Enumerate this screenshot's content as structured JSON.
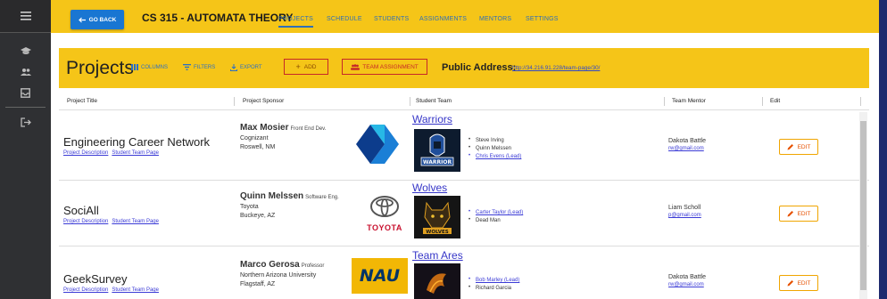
{
  "rail": {
    "icons": [
      "hamburger-menu-icon",
      "school-cap-icon",
      "people-icon",
      "inbox-icon",
      "logout-icon"
    ]
  },
  "topbar": {
    "go_back_label": "GO BACK",
    "course_title": "CS 315 - AUTOMATA THEORY",
    "tabs": [
      "PROJECTS",
      "SCHEDULE",
      "STUDENTS",
      "ASSIGNMENTS",
      "MENTORS",
      "SETTINGS"
    ],
    "active_tab": "PROJECTS"
  },
  "panel": {
    "title": "Projects",
    "columns_label": "COLUMNS",
    "filters_label": "FILTERS",
    "export_label": "EXPORT",
    "add_label": "ADD",
    "team_assignment_label": "TEAM ASSIGNMENT",
    "public_address_label": "Public Address:",
    "public_address_url": "http://34.216.91.228/team-page/30/"
  },
  "table": {
    "headers": [
      "Project Title",
      "Project Sponsor",
      "Student Team",
      "Team Mentor",
      "Edit"
    ],
    "rows": [
      {
        "project_title": "Engineering Career Network",
        "desc_link": "Project Description",
        "team_link": "Student Team Page",
        "sponsor_name": "Max Mosier",
        "sponsor_role": "Front End Dev.",
        "sponsor_org": "Cognizant",
        "sponsor_location": "Roswell, NM",
        "team_name": "Warriors",
        "members": [
          "Steve Irving",
          "Quinn Melssen",
          "Chris Evens (Lead)"
        ],
        "lead_index": 2,
        "mentor_name": "Dakota Battle",
        "mentor_email": "rw@gmail.com",
        "edit_label": "EDIT"
      },
      {
        "project_title": "SociAll",
        "desc_link": "Project Description",
        "team_link": "Student Team Page",
        "sponsor_name": "Quinn Melssen",
        "sponsor_role": "Software Eng.",
        "sponsor_org": "Toyota",
        "sponsor_location": "Buckeye, AZ",
        "logo_text": "TOYOTA",
        "team_name": "Wolves",
        "members": [
          "Carter Taylor (Lead)",
          "Dead Man"
        ],
        "lead_index": 0,
        "mentor_name": "Liam Scholl",
        "mentor_email": "p@gmail.com",
        "edit_label": "EDIT"
      },
      {
        "project_title": "GeekSurvey",
        "desc_link": "Project Description",
        "team_link": "Student Team Page",
        "sponsor_name": "Marco Gerosa",
        "sponsor_role": "Professor",
        "sponsor_org": "Northern Arizona University",
        "sponsor_location": "Flagstaff, AZ",
        "logo_text": "NAU",
        "team_name": "Team Ares",
        "members": [
          "Bob Marley (Lead)",
          "Richard Garcia"
        ],
        "lead_index": 0,
        "mentor_name": "Dakota Battle",
        "mentor_email": "rw@gmail.com",
        "edit_label": "EDIT"
      }
    ]
  },
  "colors": {
    "accent_yellow": "#f5c518",
    "primary_blue": "#1976d2",
    "link_blue": "#3b3bd6",
    "danger_red": "#c62828",
    "edit_orange": "#e65100"
  }
}
